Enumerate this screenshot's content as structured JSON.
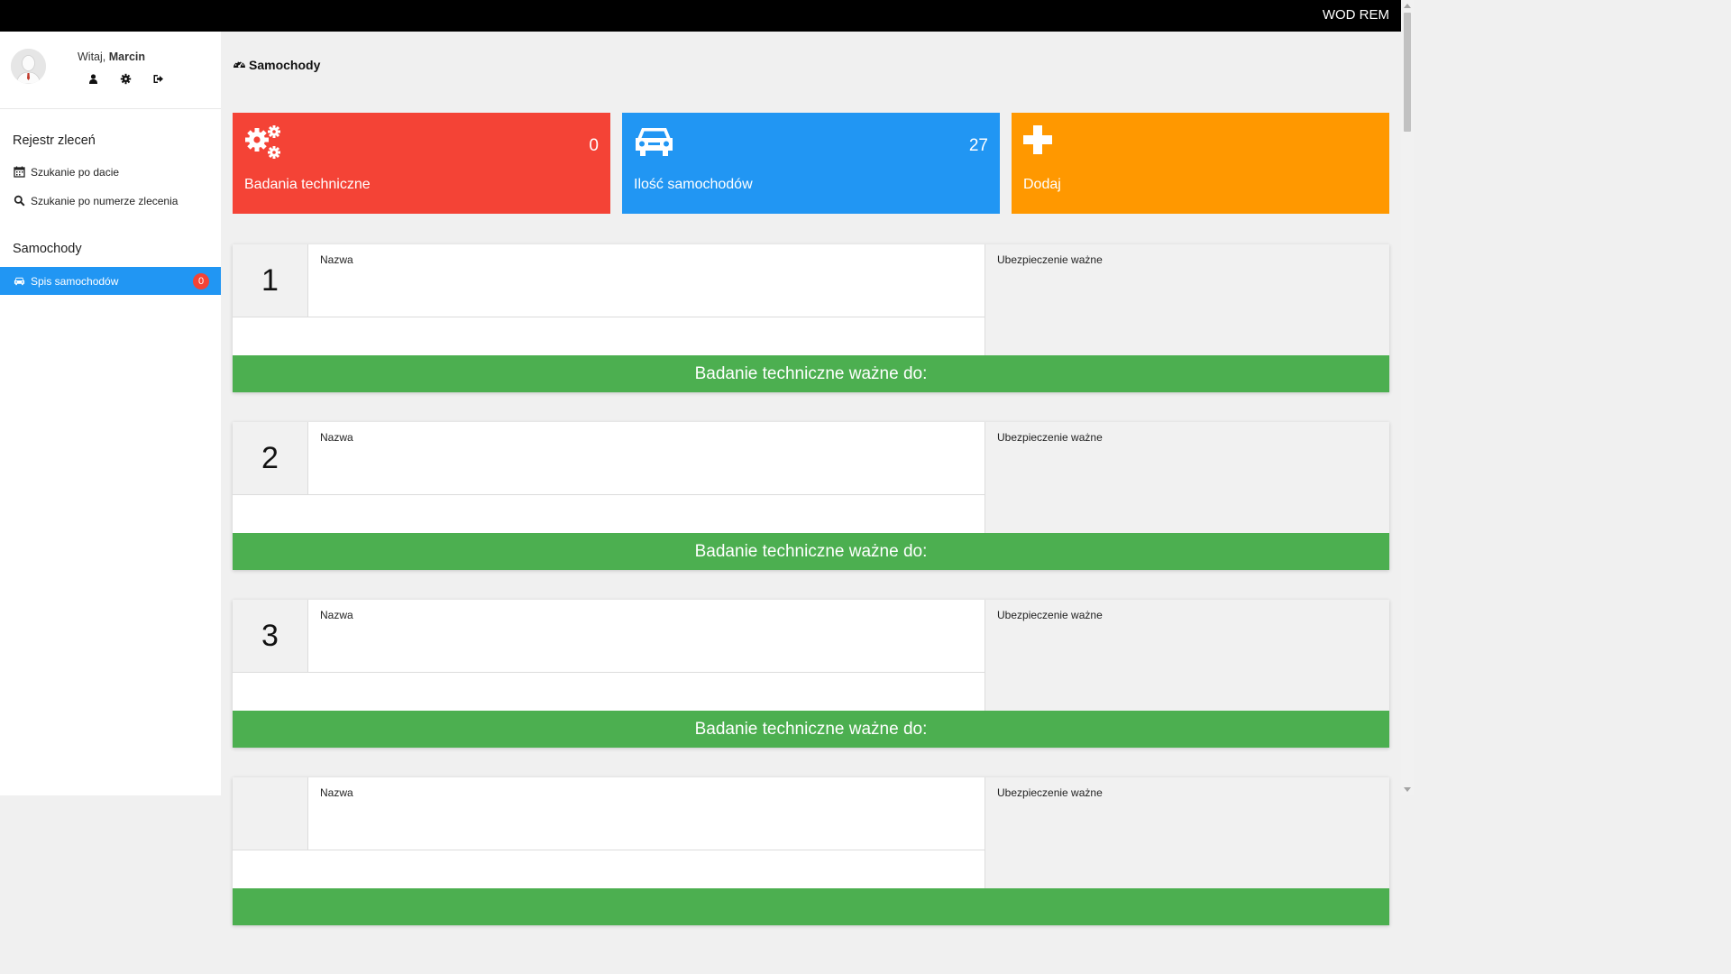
{
  "topbar": {
    "brand": "WOD REM"
  },
  "user": {
    "greeting_prefix": "Witaj, ",
    "name": "Marcin"
  },
  "sidebar": {
    "sections": [
      {
        "title": "Rejestr zleceń",
        "items": [
          {
            "label": "Szukanie po dacie",
            "icon": "calendar-icon"
          },
          {
            "label": "Szukanie po numerze zlecenia",
            "icon": "search-icon"
          }
        ]
      },
      {
        "title": "Samochody",
        "items": [
          {
            "label": "Spis samochodów",
            "icon": "car-icon",
            "badge": "0",
            "active": true
          }
        ]
      }
    ]
  },
  "page": {
    "title": "Samochody",
    "title_icon": "dashboard-icon"
  },
  "cards": [
    {
      "label": "Badania techniczne",
      "value": "0",
      "icon": "gears-icon",
      "color": "#f44336"
    },
    {
      "label": "Ilość samochodów",
      "value": "27",
      "icon": "car-icon",
      "color": "#2196f3"
    },
    {
      "label": "Dodaj",
      "value": "",
      "icon": "plus-icon",
      "color": "#ff9800"
    }
  ],
  "cars": [
    {
      "number": "1",
      "name_label": "Nazwa",
      "insurance_label": "Ubezpieczenie ważne",
      "inspection_label": "Badanie techniczne ważne do:"
    },
    {
      "number": "2",
      "name_label": "Nazwa",
      "insurance_label": "Ubezpieczenie ważne",
      "inspection_label": "Badanie techniczne ważne do:"
    },
    {
      "number": "3",
      "name_label": "Nazwa",
      "insurance_label": "Ubezpieczenie ważne",
      "inspection_label": "Badanie techniczne ważne do:"
    },
    {
      "number": "",
      "name_label": "Nazwa",
      "insurance_label": "Ubezpieczenie ważne",
      "inspection_label": ""
    }
  ],
  "colors": {
    "topbar": "#000000",
    "active": "#2196f3",
    "badge": "#f44336",
    "footer": "#4caf50"
  }
}
